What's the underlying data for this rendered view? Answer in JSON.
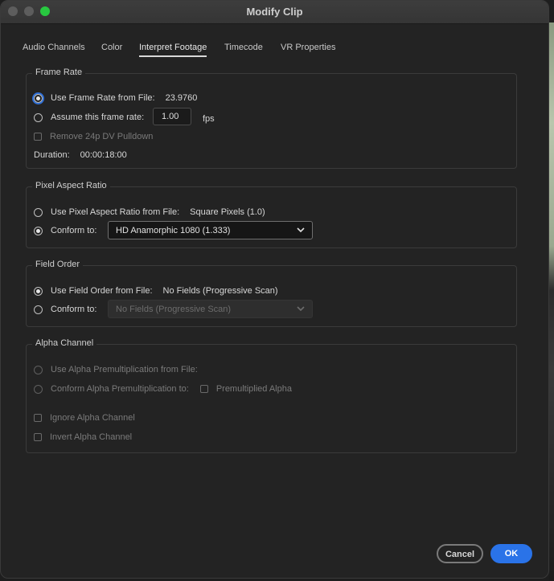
{
  "window": {
    "title": "Modify Clip"
  },
  "tabs": [
    {
      "label": "Audio Channels",
      "active": false
    },
    {
      "label": "Color",
      "active": false
    },
    {
      "label": "Interpret Footage",
      "active": true
    },
    {
      "label": "Timecode",
      "active": false
    },
    {
      "label": "VR Properties",
      "active": false
    }
  ],
  "frame_rate": {
    "title": "Frame Rate",
    "use_file_label": "Use Frame Rate from File:",
    "file_value": "23.9760",
    "assume_label": "Assume this frame rate:",
    "assume_value": "1.00",
    "fps_label": "fps",
    "pulldown_label": "Remove 24p DV Pulldown",
    "duration_label": "Duration:",
    "duration_value": "00:00:18:00"
  },
  "pixel_aspect": {
    "title": "Pixel Aspect Ratio",
    "use_file_label": "Use Pixel Aspect Ratio from File:",
    "file_value": "Square Pixels (1.0)",
    "conform_label": "Conform to:",
    "conform_value": "HD Anamorphic 1080 (1.333)"
  },
  "field_order": {
    "title": "Field Order",
    "use_file_label": "Use Field Order from File:",
    "file_value": "No Fields (Progressive Scan)",
    "conform_label": "Conform to:",
    "conform_value": "No Fields (Progressive Scan)"
  },
  "alpha": {
    "title": "Alpha Channel",
    "use_file_label": "Use Alpha Premultiplication from File:",
    "conform_label": "Conform Alpha Premultiplication to:",
    "premult_label": "Premultiplied Alpha",
    "ignore_label": "Ignore Alpha Channel",
    "invert_label": "Invert Alpha Channel"
  },
  "buttons": {
    "cancel": "Cancel",
    "ok": "OK"
  },
  "colors": {
    "accent": "#2a73e8",
    "background": "#232323",
    "maximize": "#28c840"
  }
}
